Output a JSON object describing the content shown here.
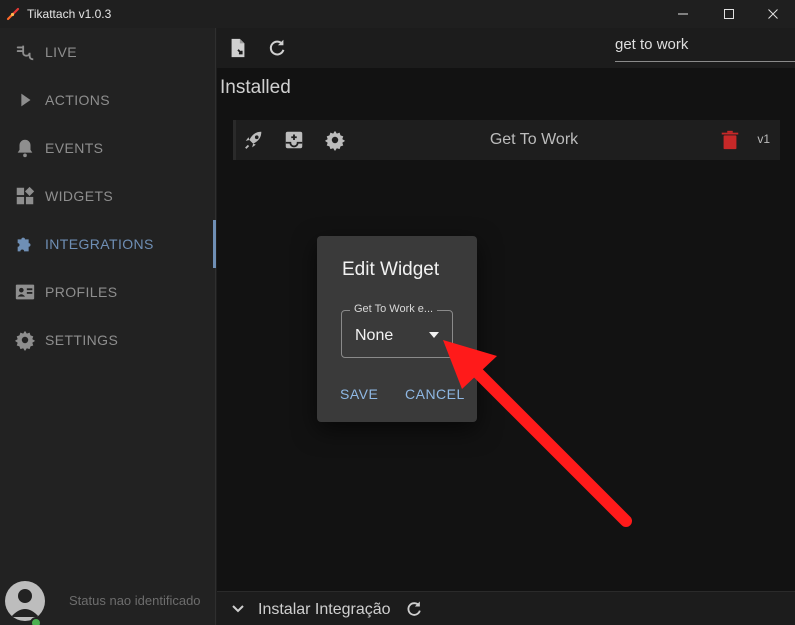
{
  "window": {
    "title": "Tikattach v1.0.3"
  },
  "sidebar": {
    "items": [
      {
        "label": "LIVE",
        "icon": "plug-icon"
      },
      {
        "label": "ACTIONS",
        "icon": "play-icon"
      },
      {
        "label": "EVENTS",
        "icon": "bell-icon"
      },
      {
        "label": "WIDGETS",
        "icon": "widgets-icon"
      },
      {
        "label": "INTEGRATIONS",
        "icon": "puzzle-icon",
        "active": true
      },
      {
        "label": "PROFILES",
        "icon": "profile-card-icon"
      },
      {
        "label": "SETTINGS",
        "icon": "gear-icon"
      }
    ],
    "status_text": "Status nao identificado"
  },
  "toolbar": {
    "search_value": "get to work"
  },
  "main": {
    "section_title": "Installed",
    "integration": {
      "name": "Get To Work",
      "version": "v1"
    },
    "footer_label": "Instalar Integração"
  },
  "dialog": {
    "title": "Edit Widget",
    "select_label": "Get To Work e...",
    "select_value": "None",
    "save_label": "SAVE",
    "cancel_label": "CANCEL"
  },
  "colors": {
    "accent": "#6f8fb5",
    "dialog_button": "#8fb8e4",
    "delete_red": "#c62828",
    "annotation_arrow": "#ff1a1a"
  }
}
